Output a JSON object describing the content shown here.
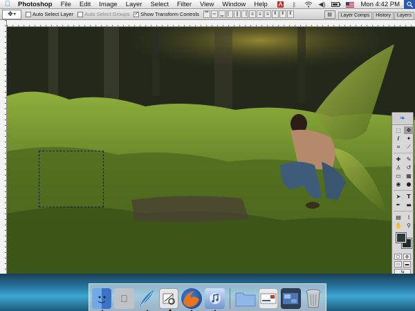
{
  "menubar": {
    "apple_icon": "apple-icon",
    "app_name": "Photoshop",
    "menus": [
      "File",
      "Edit",
      "Image",
      "Layer",
      "Select",
      "Filter",
      "View",
      "Window",
      "Help"
    ],
    "clock": "Mon 4:42 PM",
    "status_icons": [
      "adobe-updater-icon",
      "bluetooth-icon",
      "wifi-icon",
      "volume-icon",
      "battery-icon",
      "flag-icon"
    ]
  },
  "options_bar": {
    "auto_select_layer": "Auto Select Layer",
    "auto_select_groups": "Auto Select Groups",
    "show_transform_controls": "Show Transform Controls",
    "palette_tabs": [
      "Layer Comps",
      "History",
      "Layers"
    ]
  },
  "tools": {
    "foreground_color": "#2d3a3a",
    "background_color": "#1e2a2a"
  },
  "dock": {
    "apps": [
      "finder-icon",
      "system-preferences-icon",
      "photoshop-feather-icon",
      "preview-icon",
      "firefox-icon",
      "itunes-icon"
    ],
    "docs": [
      "folder-icon",
      "mail-icon",
      "screen-icon",
      "trash-icon"
    ]
  }
}
